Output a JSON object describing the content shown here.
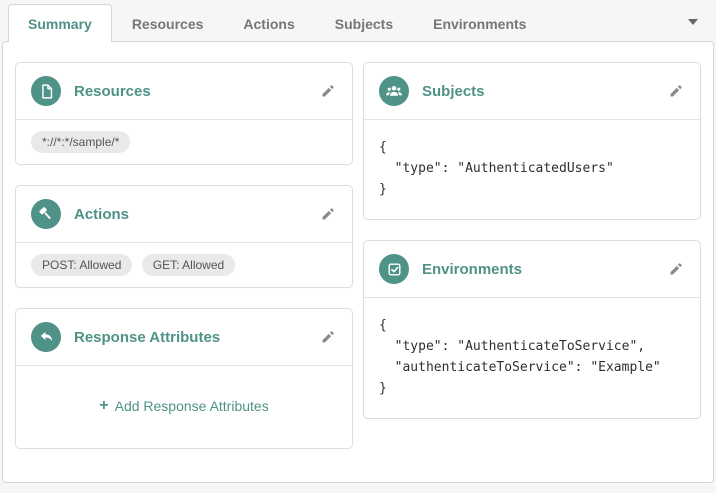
{
  "tab_bar": {
    "tabs": [
      {
        "label": "Summary",
        "active": true
      },
      {
        "label": "Resources",
        "active": false
      },
      {
        "label": "Actions",
        "active": false
      },
      {
        "label": "Subjects",
        "active": false
      },
      {
        "label": "Environments",
        "active": false
      }
    ]
  },
  "colors": {
    "accent_teal": "#4f9287",
    "tab_inactive_text": "#76767a",
    "panel_border": "#d5d5d6",
    "card_border": "#dddddd",
    "pill_background": "#e9e9e9",
    "pill_text": "#555555",
    "json_text": "#2f2f2f",
    "edit_icon": "#8a8a8a"
  },
  "cards": {
    "resources": {
      "title": "Resources",
      "icon": "file-icon",
      "pills": [
        "*://*:*/sample/*"
      ]
    },
    "actions": {
      "title": "Actions",
      "icon": "gavel-icon",
      "pills": [
        "POST: Allowed",
        "GET: Allowed"
      ]
    },
    "response_attributes": {
      "title": "Response Attributes",
      "icon": "reply-arrow-icon",
      "plus": "+",
      "add_label": "Add Response Attributes"
    },
    "subjects": {
      "title": "Subjects",
      "icon": "users-icon",
      "json": "{\n  \"type\": \"AuthenticatedUsers\"\n}"
    },
    "environments": {
      "title": "Environments",
      "icon": "checkbox-icon",
      "json": "{\n  \"type\": \"AuthenticateToService\",\n  \"authenticateToService\": \"Example\"\n}"
    }
  }
}
